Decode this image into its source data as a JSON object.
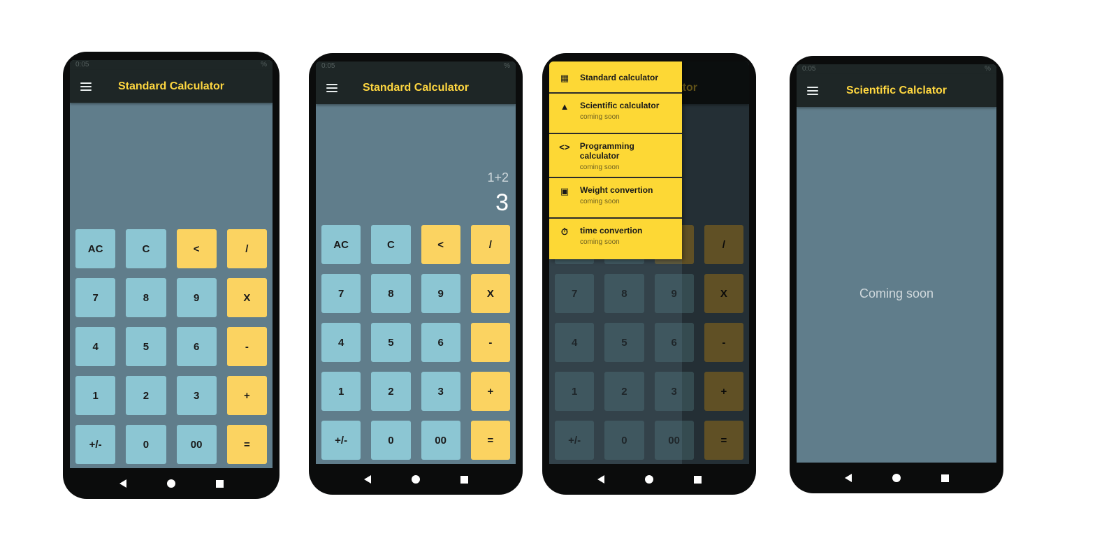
{
  "phones": [
    {
      "status": {
        "time": "0:05",
        "right": "%"
      },
      "title": "Standard Calculator",
      "keys": [
        {
          "label": "AC",
          "kind": "num"
        },
        {
          "label": "C",
          "kind": "num"
        },
        {
          "label": "<",
          "kind": "op"
        },
        {
          "label": "/",
          "kind": "op"
        },
        {
          "label": "7",
          "kind": "num"
        },
        {
          "label": "8",
          "kind": "num"
        },
        {
          "label": "9",
          "kind": "num"
        },
        {
          "label": "X",
          "kind": "op"
        },
        {
          "label": "4",
          "kind": "num"
        },
        {
          "label": "5",
          "kind": "num"
        },
        {
          "label": "6",
          "kind": "num"
        },
        {
          "label": "-",
          "kind": "op"
        },
        {
          "label": "1",
          "kind": "num"
        },
        {
          "label": "2",
          "kind": "num"
        },
        {
          "label": "3",
          "kind": "num"
        },
        {
          "label": "+",
          "kind": "op"
        },
        {
          "label": "+/-",
          "kind": "num"
        },
        {
          "label": "0",
          "kind": "num"
        },
        {
          "label": "00",
          "kind": "num"
        },
        {
          "label": "=",
          "kind": "op"
        }
      ]
    },
    {
      "status": {
        "time": "0:05",
        "right": "%"
      },
      "title": "Standard Calculator",
      "display": {
        "expression": "1+2",
        "result": "3"
      },
      "keys": [
        {
          "label": "AC",
          "kind": "num"
        },
        {
          "label": "C",
          "kind": "num"
        },
        {
          "label": "<",
          "kind": "op"
        },
        {
          "label": "/",
          "kind": "op"
        },
        {
          "label": "7",
          "kind": "num"
        },
        {
          "label": "8",
          "kind": "num"
        },
        {
          "label": "9",
          "kind": "num"
        },
        {
          "label": "X",
          "kind": "op"
        },
        {
          "label": "4",
          "kind": "num"
        },
        {
          "label": "5",
          "kind": "num"
        },
        {
          "label": "6",
          "kind": "num"
        },
        {
          "label": "-",
          "kind": "op"
        },
        {
          "label": "1",
          "kind": "num"
        },
        {
          "label": "2",
          "kind": "num"
        },
        {
          "label": "3",
          "kind": "num"
        },
        {
          "label": "+",
          "kind": "op"
        },
        {
          "label": "+/-",
          "kind": "num"
        },
        {
          "label": "0",
          "kind": "num"
        },
        {
          "label": "00",
          "kind": "num"
        },
        {
          "label": "=",
          "kind": "op"
        }
      ]
    },
    {
      "title_fragment": "ator",
      "keys": [
        {
          "label": "",
          "kind": "num"
        },
        {
          "label": "",
          "kind": "num"
        },
        {
          "label": "",
          "kind": "op"
        },
        {
          "label": "/",
          "kind": "op"
        },
        {
          "label": "7",
          "kind": "num"
        },
        {
          "label": "8",
          "kind": "num"
        },
        {
          "label": "9",
          "kind": "num"
        },
        {
          "label": "X",
          "kind": "op"
        },
        {
          "label": "4",
          "kind": "num"
        },
        {
          "label": "5",
          "kind": "num"
        },
        {
          "label": "6",
          "kind": "num"
        },
        {
          "label": "-",
          "kind": "op"
        },
        {
          "label": "1",
          "kind": "num"
        },
        {
          "label": "2",
          "kind": "num"
        },
        {
          "label": "3",
          "kind": "num"
        },
        {
          "label": "+",
          "kind": "op"
        },
        {
          "label": "+/-",
          "kind": "num"
        },
        {
          "label": "0",
          "kind": "num"
        },
        {
          "label": "00",
          "kind": "num"
        },
        {
          "label": "=",
          "kind": "op"
        }
      ],
      "drawer": [
        {
          "icon": "calculator-icon",
          "glyph": "▦",
          "title": "Standard calculator",
          "subtitle": ""
        },
        {
          "icon": "flask-icon",
          "glyph": "▲",
          "title": "Scientific calculator",
          "subtitle": "coming soon"
        },
        {
          "icon": "code-icon",
          "glyph": "<>",
          "title": "Programming calculator",
          "subtitle": "coming soon"
        },
        {
          "icon": "scale-icon",
          "glyph": "▣",
          "title": "Weight convertion",
          "subtitle": "coming soon"
        },
        {
          "icon": "timer-icon",
          "glyph": "⏱",
          "title": "time convertion",
          "subtitle": "coming soon"
        }
      ]
    },
    {
      "status": {
        "time": "0:05",
        "right": "%"
      },
      "title": "Scientific Calclator",
      "body_text": "Coming soon"
    }
  ],
  "colors": {
    "appbar": "#1e2626",
    "screen": "#607d8b",
    "title": "#ffd740",
    "key_number": "#8cc6d3",
    "key_operator": "#fbd361",
    "drawer": "#fdd835"
  },
  "nav_icons": [
    "back-icon",
    "home-icon",
    "recent-apps-icon"
  ]
}
